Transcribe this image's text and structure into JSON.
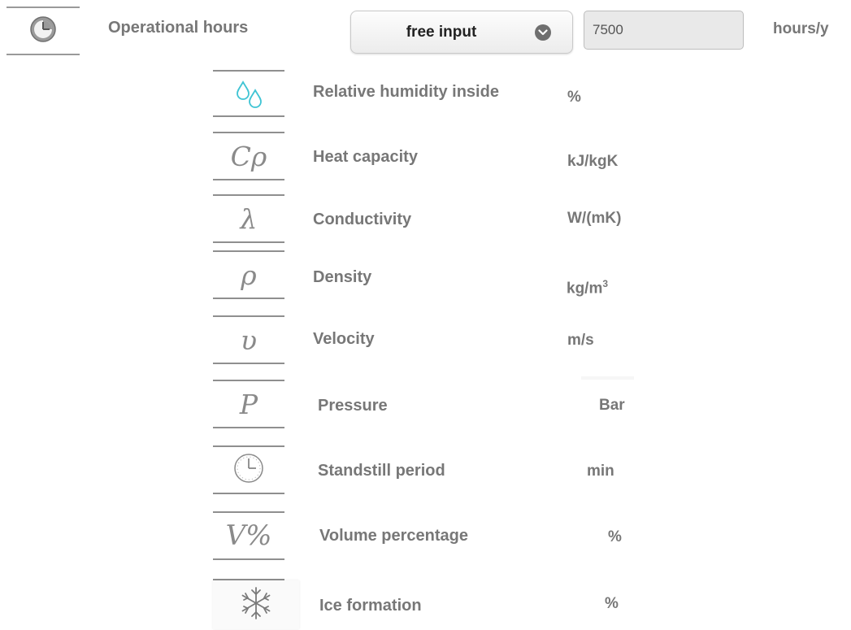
{
  "operational": {
    "icon": "clock-icon",
    "label": "Operational hours",
    "mode_select": "free input",
    "value": "7500",
    "unit": "hours/y"
  },
  "parameters": [
    {
      "icon": "water-drops-icon",
      "symbol": "",
      "label": "Relative humidity inside",
      "unit": "%"
    },
    {
      "icon": "heat-capacity-symbol",
      "symbol": "Cρ",
      "label": "Heat capacity",
      "unit": "kJ/kgK"
    },
    {
      "icon": "lambda-symbol",
      "symbol": "λ",
      "label": "Conductivity",
      "unit": "W/(mK)"
    },
    {
      "icon": "rho-symbol",
      "symbol": "ρ",
      "label": "Density",
      "unit": "kg/m",
      "unit_sup": "3"
    },
    {
      "icon": "upsilon-symbol",
      "symbol": "υ",
      "label": "Velocity",
      "unit": "m/s"
    },
    {
      "icon": "p-symbol",
      "symbol": "P",
      "label": "Pressure",
      "unit": "Bar"
    },
    {
      "icon": "clock-icon",
      "symbol": "",
      "label": "Standstill period",
      "unit": "min"
    },
    {
      "icon": "volume-percent-symbol",
      "symbol": "V%",
      "label": "Volume percentage",
      "unit": "%"
    },
    {
      "icon": "snowflake-icon",
      "symbol": "",
      "label": "Ice formation",
      "unit": "%"
    }
  ],
  "colors": {
    "text": "#777777",
    "drops": "#3fc4d4",
    "rule": "#8f8f8f"
  }
}
